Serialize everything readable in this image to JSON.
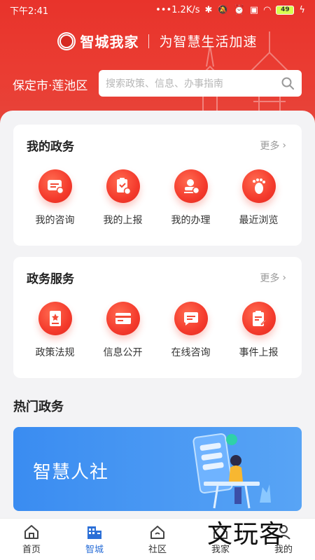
{
  "status_bar": {
    "time": "下午2:41",
    "network_speed": "1.2K/s",
    "battery": "49"
  },
  "brand": {
    "name": "智城我家",
    "slogan": "为智慧生活加速"
  },
  "location": "保定市·莲池区",
  "search": {
    "placeholder": "搜索政策、信息、办事指南"
  },
  "my_affairs": {
    "title": "我的政务",
    "more": "更多",
    "items": [
      {
        "label": "我的咨询",
        "icon": "consult-icon"
      },
      {
        "label": "我的上报",
        "icon": "report-icon"
      },
      {
        "label": "我的办理",
        "icon": "handle-icon"
      },
      {
        "label": "最近浏览",
        "icon": "footprint-icon"
      }
    ]
  },
  "gov_services": {
    "title": "政务服务",
    "more": "更多",
    "items": [
      {
        "label": "政策法规",
        "icon": "policy-icon"
      },
      {
        "label": "信息公开",
        "icon": "info-icon"
      },
      {
        "label": "在线咨询",
        "icon": "chat-icon"
      },
      {
        "label": "事件上报",
        "icon": "event-report-icon"
      }
    ]
  },
  "hot": {
    "title": "热门政务",
    "banner_text": "智慧人社"
  },
  "nav": {
    "items": [
      {
        "label": "首页",
        "icon": "home-icon",
        "active": false
      },
      {
        "label": "智城",
        "icon": "city-icon",
        "active": true
      },
      {
        "label": "社区",
        "icon": "community-icon",
        "active": false
      },
      {
        "label": "我家",
        "icon": "family-icon",
        "active": false
      },
      {
        "label": "我的",
        "icon": "profile-icon",
        "active": false
      }
    ]
  },
  "watermark": "文玩客",
  "colors": {
    "brand_red": "#e8332b",
    "active_blue": "#2b6fd7",
    "banner_blue": "#3a8cf1"
  }
}
